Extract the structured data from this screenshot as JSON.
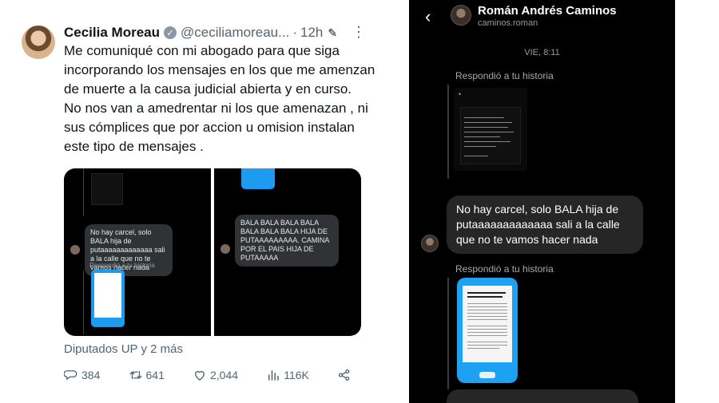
{
  "tweet": {
    "author_name": "Cecilia Moreau",
    "handle": "@ceciliamoreau...",
    "separator": "·",
    "time": "12h",
    "body": "Me comuniqué con mi abogado para que siga incorporando los mensajes en los que me amenzan de muerte a la causa judicial abierta y en curso.\nNo nos van a amedrentar ni los que amenazan , ni sus cómplices que por accion u omision instalan  este tipo de mensajes .",
    "media_left": {
      "message": "No hay carcel,  solo BALA hija de putaaaaaaaaaaaaa sali a la calle que no te vamos hacer nada",
      "reply_label": "Respondió a tu historia"
    },
    "media_right": {
      "message": "BALA BALA BALA BALA BALA BALA BALA HIJA DE PUTAAAAAAAAA. CAMINA POR EL PAIS HIJA DE PUTAAAAA"
    },
    "reply_context": "Diputados UP y 2 más",
    "stats": {
      "replies": "384",
      "retweets": "641",
      "likes": "2,044",
      "views": "116K"
    },
    "colors": {
      "text": "#0f1419",
      "muted": "#536471"
    }
  },
  "dm": {
    "contact_name": "Román Andrés Caminos",
    "contact_username": "caminos.roman",
    "date_label": "VIE, 8:11",
    "reply_label_1": "Respondió a tu historia",
    "reply_label_2": "Respondió a tu historia",
    "message": "No hay carcel,  solo BALA hija de putaaaaaaaaaaaaa sali a la calle que no te vamos hacer nada",
    "colors": {
      "background": "#000000",
      "bubble": "#262626",
      "phone": "#1da1f2"
    }
  },
  "icons": [
    "verified-icon",
    "edit-icon",
    "more-icon",
    "reply-icon",
    "retweet-icon",
    "like-icon",
    "views-icon",
    "share-icon",
    "back-icon"
  ]
}
